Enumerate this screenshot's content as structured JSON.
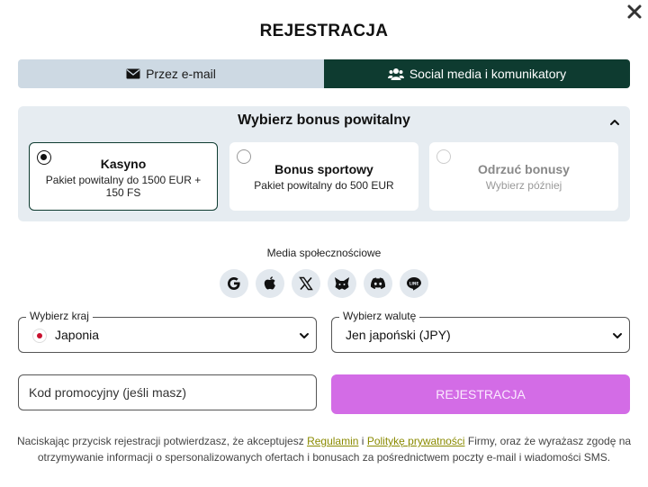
{
  "modal": {
    "title": "REJESTRACJA",
    "close_icon": "close-icon"
  },
  "tabs": [
    {
      "label": "Przez e-mail",
      "icon": "envelope-icon",
      "active": false
    },
    {
      "label": "Social media i komunikatory",
      "icon": "users-icon",
      "active": true
    }
  ],
  "bonus": {
    "title": "Wybierz bonus powitalny",
    "options": [
      {
        "name": "Kasyno",
        "desc": "Pakiet powitalny do 1500 EUR + 150 FS",
        "selected": true
      },
      {
        "name": "Bonus sportowy",
        "desc": "Pakiet powitalny do 500 EUR",
        "selected": false
      },
      {
        "name": "Odrzuć bonusy",
        "desc": "Wybierz później",
        "selected": false
      }
    ]
  },
  "social": {
    "label": "Media społecznościowe",
    "providers": [
      "google-icon",
      "apple-icon",
      "x-icon",
      "metamask-icon",
      "discord-icon",
      "line-icon"
    ]
  },
  "country": {
    "label": "Wybierz kraj",
    "value": "Japonia",
    "flag": "japan-flag-icon"
  },
  "currency": {
    "label": "Wybierz walutę",
    "value": "Jen japoński (JPY)"
  },
  "promo": {
    "placeholder": "Kod promocyjny (jeśli masz)"
  },
  "register_button": {
    "label": "REJESTRACJA"
  },
  "terms": {
    "part1": "Naciskając przycisk rejestracji potwierdzasz, że akceptujesz",
    "link1": "Regulamin",
    "part2": "i",
    "link2": "Politykę prywatności",
    "part3": "Firmy, oraz że wyrażasz zgodę na otrzymywanie informacji o spersonalizowanych ofertach i bonusach za pośrednictwem poczty e-mail i wiadomości SMS."
  },
  "colors": {
    "accent_dark": "#0e3b30",
    "tab_inactive": "#cdd9e3",
    "panel_bg": "#e6ecf1",
    "register_button": "#d36ce6",
    "link": "#8a8a00"
  }
}
